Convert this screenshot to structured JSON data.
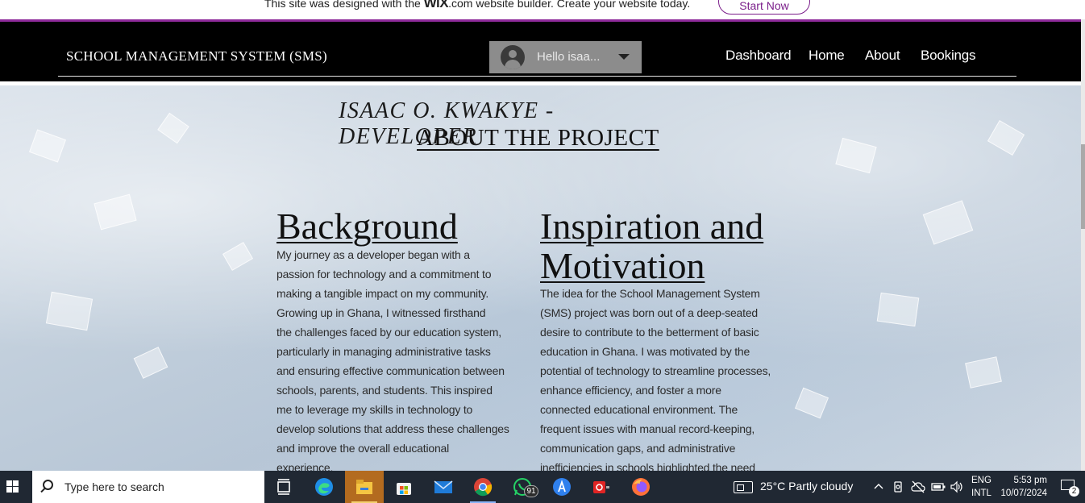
{
  "wix_banner": {
    "text_before": "This site was designed with the",
    "brand": "WiX",
    "text_after": ".com website builder. Create your website today.",
    "cta": "Start Now",
    "accent_color": "#8e2a9a"
  },
  "header": {
    "site_title": "SCHOOL MANAGEMENT SYSTEM (SMS)",
    "user_greeting": "Hello isaa...",
    "nav": [
      "Dashboard",
      "Home",
      "About",
      "Bookings"
    ]
  },
  "main": {
    "developer": "ISAAC O. KWAKYE - DEVELOPER",
    "section_title": "ABOUT THE PROJECT",
    "background": {
      "heading": "Background",
      "lines": [
        "My journey as a developer began with a",
        "passion for technology and a commitment to",
        "making a tangible impact on my community.",
        "Growing up in Ghana, I witnessed firsthand",
        "the challenges faced by our education system,",
        "particularly in managing administrative tasks",
        "and ensuring effective communication between",
        "schools, parents, and students. This inspired",
        "me to leverage my skills in technology to",
        "develop solutions that address these challenges",
        "and improve the overall educational",
        "experience."
      ]
    },
    "inspiration": {
      "heading_line1": "Inspiration and",
      "heading_line2": "Motivation",
      "lines": [
        "The idea for the School Management System",
        "(SMS) project was born out of a deep-seated",
        "desire to contribute to the betterment of basic",
        "education in Ghana. I was motivated by the",
        "potential of technology to streamline processes,",
        "enhance efficiency, and foster a more",
        "connected educational environment. The",
        "frequent issues with manual record-keeping,",
        "communication gaps, and administrative",
        "inefficiencies in schools highlighted the need"
      ]
    }
  },
  "taskbar": {
    "search_placeholder": "Type here to search",
    "apps": [
      {
        "icon": "task-view-icon"
      },
      {
        "icon": "edge-icon"
      },
      {
        "icon": "file-explorer-icon"
      },
      {
        "icon": "microsoft-store-icon"
      },
      {
        "icon": "mail-icon"
      },
      {
        "icon": "chrome-icon"
      },
      {
        "icon": "whatsapp-icon",
        "badge": "91"
      },
      {
        "icon": "app-store-icon"
      },
      {
        "icon": "red-app-icon"
      },
      {
        "icon": "firefox-icon"
      }
    ],
    "weather": "25°C  Partly cloudy",
    "lang_line1": "ENG",
    "lang_line2": "INTL",
    "time": "5:53 pm",
    "date": "10/07/2024",
    "notification_count": "2"
  }
}
